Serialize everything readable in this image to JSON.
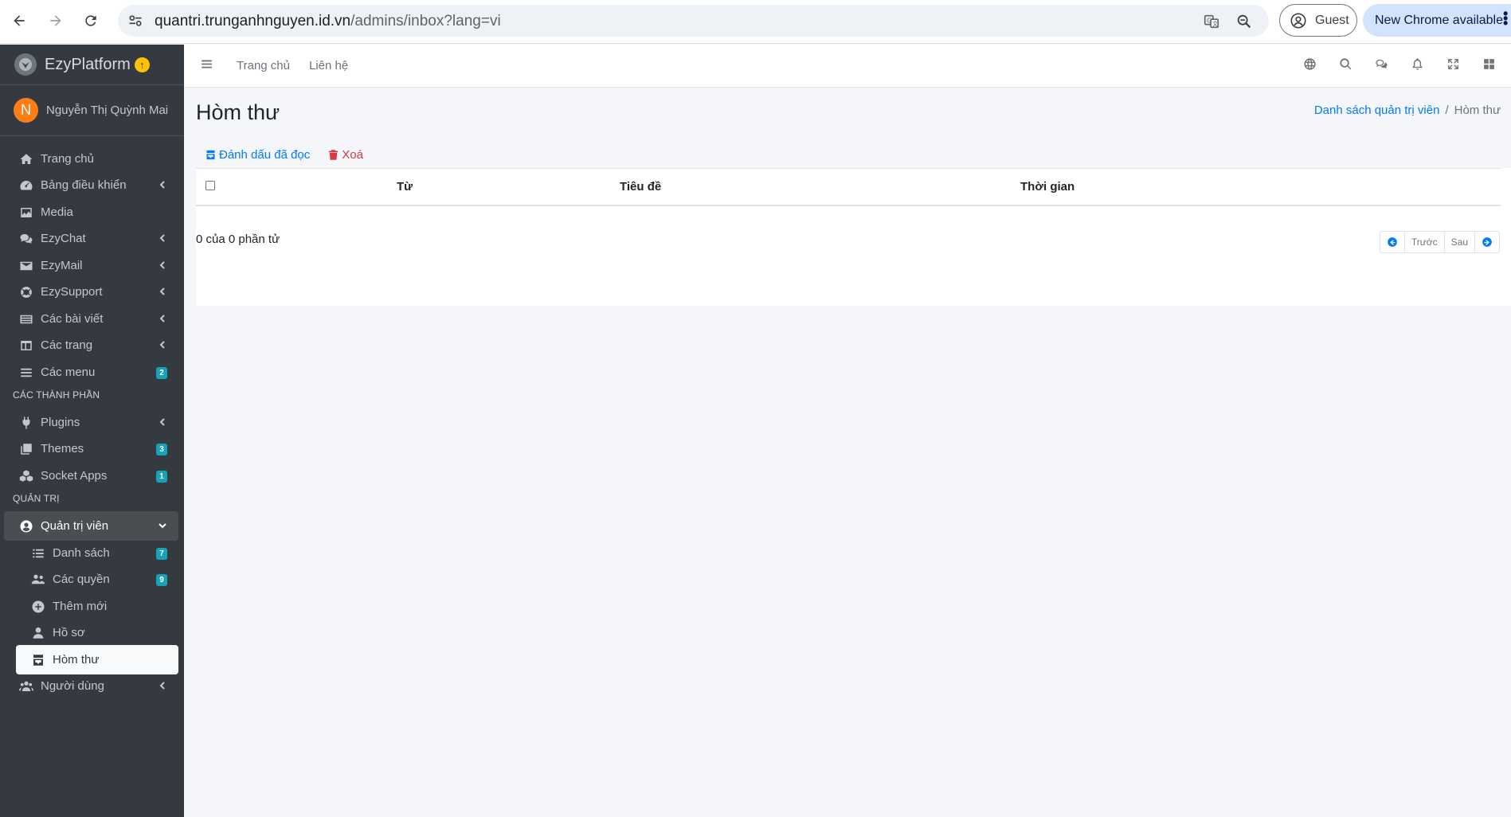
{
  "browser": {
    "url_host": "quantri.trunganhnguyen.id.vn",
    "url_path": "/admins/inbox?lang=vi",
    "profile_label": "Guest",
    "update_label": "New Chrome available"
  },
  "sidebar": {
    "brand": "EzyPlatform",
    "user_initial": "N",
    "user_name": "Nguyễn Thị Quỳnh Mai",
    "items": [
      {
        "label": "Trang chủ",
        "icon": "home-icon"
      },
      {
        "label": "Bảng điều khiển",
        "icon": "dashboard-icon"
      },
      {
        "label": "Media",
        "icon": "image-icon"
      },
      {
        "label": "EzyChat",
        "icon": "chat-icon"
      },
      {
        "label": "EzyMail",
        "icon": "mail-icon"
      },
      {
        "label": "EzySupport",
        "icon": "support-icon"
      },
      {
        "label": "Các bài viết",
        "icon": "posts-icon"
      },
      {
        "label": "Các trang",
        "icon": "pages-icon"
      },
      {
        "label": "Các menu",
        "icon": "menu-icon",
        "badge": "2"
      }
    ],
    "section_components": "CÁC THÀNH PHẦN",
    "components": [
      {
        "label": "Plugins",
        "icon": "plug-icon"
      },
      {
        "label": "Themes",
        "icon": "themes-icon",
        "badge": "3"
      },
      {
        "label": "Socket Apps",
        "icon": "cubes-icon",
        "badge": "1"
      }
    ],
    "section_admin": "QUẢN TRỊ",
    "admin": {
      "label": "Quản trị viên",
      "children": [
        {
          "label": "Danh sách",
          "icon": "list-icon",
          "badge": "7"
        },
        {
          "label": "Các quyền",
          "icon": "users-cog-icon",
          "badge": "9"
        },
        {
          "label": "Thêm mới",
          "icon": "plus-circle-icon"
        },
        {
          "label": "Hồ sơ",
          "icon": "user-icon"
        },
        {
          "label": "Hòm thư",
          "icon": "inbox-icon"
        }
      ]
    },
    "users_label": "Người dùng"
  },
  "header": {
    "links": [
      "Trang chủ",
      "Liên hệ"
    ]
  },
  "page": {
    "title": "Hòm thư",
    "breadcrumb_parent": "Danh sách quản trị viên",
    "breadcrumb_current": "Hòm thư",
    "mark_read_label": "Đánh dấu đã đọc",
    "delete_label": "Xoá",
    "columns": [
      "Từ",
      "Tiêu đề",
      "Thời gian"
    ],
    "summary": "0 của 0 phần tử",
    "prev_label": "Trước",
    "next_label": "Sau"
  },
  "colors": {
    "sidebar_bg": "#343a40",
    "accent": "#007bff",
    "danger": "#dc3545",
    "badge": "#17a2b8"
  }
}
